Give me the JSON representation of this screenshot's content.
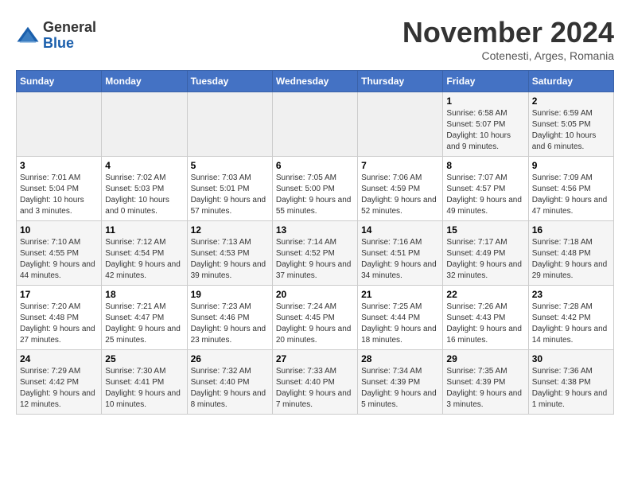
{
  "logo": {
    "general": "General",
    "blue": "Blue"
  },
  "title": "November 2024",
  "subtitle": "Cotenesti, Arges, Romania",
  "days_of_week": [
    "Sunday",
    "Monday",
    "Tuesday",
    "Wednesday",
    "Thursday",
    "Friday",
    "Saturday"
  ],
  "weeks": [
    [
      {
        "day": "",
        "info": ""
      },
      {
        "day": "",
        "info": ""
      },
      {
        "day": "",
        "info": ""
      },
      {
        "day": "",
        "info": ""
      },
      {
        "day": "",
        "info": ""
      },
      {
        "day": "1",
        "info": "Sunrise: 6:58 AM\nSunset: 5:07 PM\nDaylight: 10 hours and 9 minutes."
      },
      {
        "day": "2",
        "info": "Sunrise: 6:59 AM\nSunset: 5:05 PM\nDaylight: 10 hours and 6 minutes."
      }
    ],
    [
      {
        "day": "3",
        "info": "Sunrise: 7:01 AM\nSunset: 5:04 PM\nDaylight: 10 hours and 3 minutes."
      },
      {
        "day": "4",
        "info": "Sunrise: 7:02 AM\nSunset: 5:03 PM\nDaylight: 10 hours and 0 minutes."
      },
      {
        "day": "5",
        "info": "Sunrise: 7:03 AM\nSunset: 5:01 PM\nDaylight: 9 hours and 57 minutes."
      },
      {
        "day": "6",
        "info": "Sunrise: 7:05 AM\nSunset: 5:00 PM\nDaylight: 9 hours and 55 minutes."
      },
      {
        "day": "7",
        "info": "Sunrise: 7:06 AM\nSunset: 4:59 PM\nDaylight: 9 hours and 52 minutes."
      },
      {
        "day": "8",
        "info": "Sunrise: 7:07 AM\nSunset: 4:57 PM\nDaylight: 9 hours and 49 minutes."
      },
      {
        "day": "9",
        "info": "Sunrise: 7:09 AM\nSunset: 4:56 PM\nDaylight: 9 hours and 47 minutes."
      }
    ],
    [
      {
        "day": "10",
        "info": "Sunrise: 7:10 AM\nSunset: 4:55 PM\nDaylight: 9 hours and 44 minutes."
      },
      {
        "day": "11",
        "info": "Sunrise: 7:12 AM\nSunset: 4:54 PM\nDaylight: 9 hours and 42 minutes."
      },
      {
        "day": "12",
        "info": "Sunrise: 7:13 AM\nSunset: 4:53 PM\nDaylight: 9 hours and 39 minutes."
      },
      {
        "day": "13",
        "info": "Sunrise: 7:14 AM\nSunset: 4:52 PM\nDaylight: 9 hours and 37 minutes."
      },
      {
        "day": "14",
        "info": "Sunrise: 7:16 AM\nSunset: 4:51 PM\nDaylight: 9 hours and 34 minutes."
      },
      {
        "day": "15",
        "info": "Sunrise: 7:17 AM\nSunset: 4:49 PM\nDaylight: 9 hours and 32 minutes."
      },
      {
        "day": "16",
        "info": "Sunrise: 7:18 AM\nSunset: 4:48 PM\nDaylight: 9 hours and 29 minutes."
      }
    ],
    [
      {
        "day": "17",
        "info": "Sunrise: 7:20 AM\nSunset: 4:48 PM\nDaylight: 9 hours and 27 minutes."
      },
      {
        "day": "18",
        "info": "Sunrise: 7:21 AM\nSunset: 4:47 PM\nDaylight: 9 hours and 25 minutes."
      },
      {
        "day": "19",
        "info": "Sunrise: 7:23 AM\nSunset: 4:46 PM\nDaylight: 9 hours and 23 minutes."
      },
      {
        "day": "20",
        "info": "Sunrise: 7:24 AM\nSunset: 4:45 PM\nDaylight: 9 hours and 20 minutes."
      },
      {
        "day": "21",
        "info": "Sunrise: 7:25 AM\nSunset: 4:44 PM\nDaylight: 9 hours and 18 minutes."
      },
      {
        "day": "22",
        "info": "Sunrise: 7:26 AM\nSunset: 4:43 PM\nDaylight: 9 hours and 16 minutes."
      },
      {
        "day": "23",
        "info": "Sunrise: 7:28 AM\nSunset: 4:42 PM\nDaylight: 9 hours and 14 minutes."
      }
    ],
    [
      {
        "day": "24",
        "info": "Sunrise: 7:29 AM\nSunset: 4:42 PM\nDaylight: 9 hours and 12 minutes."
      },
      {
        "day": "25",
        "info": "Sunrise: 7:30 AM\nSunset: 4:41 PM\nDaylight: 9 hours and 10 minutes."
      },
      {
        "day": "26",
        "info": "Sunrise: 7:32 AM\nSunset: 4:40 PM\nDaylight: 9 hours and 8 minutes."
      },
      {
        "day": "27",
        "info": "Sunrise: 7:33 AM\nSunset: 4:40 PM\nDaylight: 9 hours and 7 minutes."
      },
      {
        "day": "28",
        "info": "Sunrise: 7:34 AM\nSunset: 4:39 PM\nDaylight: 9 hours and 5 minutes."
      },
      {
        "day": "29",
        "info": "Sunrise: 7:35 AM\nSunset: 4:39 PM\nDaylight: 9 hours and 3 minutes."
      },
      {
        "day": "30",
        "info": "Sunrise: 7:36 AM\nSunset: 4:38 PM\nDaylight: 9 hours and 1 minute."
      }
    ]
  ]
}
